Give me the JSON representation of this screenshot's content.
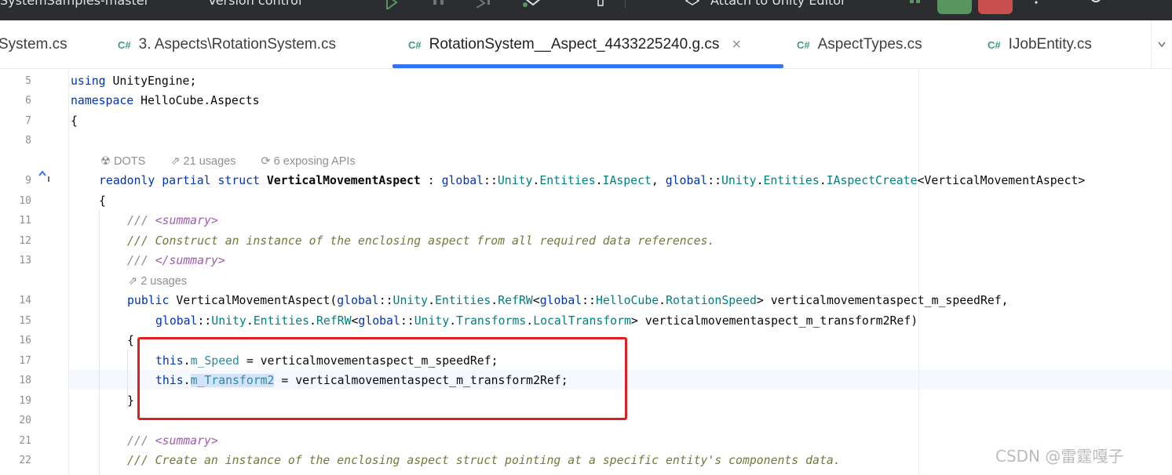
{
  "toolbar": {
    "project_name": "SystemSamples-master",
    "vcs_label": "Version control",
    "attach_label": "Attach to Unity Editor"
  },
  "tabs": [
    {
      "label": "System.cs",
      "cs": "",
      "active": false
    },
    {
      "label": "3. Aspects\\RotationSystem.cs",
      "cs": "C#",
      "active": false
    },
    {
      "label": "RotationSystem__Aspect_4433225240.g.cs",
      "cs": "C#",
      "active": true
    },
    {
      "label": "AspectTypes.cs",
      "cs": "C#",
      "active": false
    },
    {
      "label": "IJobEntity.cs",
      "cs": "C#",
      "active": false
    }
  ],
  "tab_close": "×",
  "inlay_hints": {
    "dots": "DOTS",
    "usages_21": "21 usages",
    "exposing": "6 exposing APIs",
    "usages_2": "2 usages"
  },
  "line_numbers": [
    "5",
    "6",
    "7",
    "8",
    "9",
    "10",
    "11",
    "12",
    "13",
    "14",
    "15",
    "16",
    "17",
    "18",
    "19",
    "20",
    "21",
    "22"
  ],
  "code": {
    "l5_kw": "using",
    "l5_rest": " UnityEngine;",
    "l6_kw": "namespace",
    "l6_rest": " HelloCube.Aspects",
    "l7": "{",
    "l9_kw1": "readonly",
    "l9_kw2": "partial",
    "l9_kw3": "struct",
    "l9_name": "VerticalMovementAspect",
    "l9_colon": " : ",
    "l9_g1": "global",
    "l9_sep": "::",
    "l9_unity": "Unity",
    "l9_entities": "Entities",
    "l9_iaspect": "IAspect",
    "l9_comma": ", ",
    "l9_g2": "global",
    "l9_iaspectcreate": "IAspectCreate",
    "l9_generic": "<VerticalMovementAspect>",
    "l10": "{",
    "l11_slash": "/// ",
    "l11_tag": "<summary>",
    "l12": "/// Construct an instance of the enclosing aspect from all required data references.",
    "l13_slash": "/// ",
    "l13_tag": "</summary>",
    "l14_public": "public",
    "l14_ctor": " VerticalMovementAspect(",
    "l14_global": "global",
    "l14_unity": "Unity",
    "l14_entities": "Entities",
    "l14_refrw": "RefRW",
    "l14_lt": "<",
    "l14_global2": "global",
    "l14_hellocube": "HelloCube",
    "l14_rotspeed": "RotationSpeed",
    "l14_param": "> verticalmovementaspect_m_speedRef,",
    "l15_global": "global",
    "l15_unity": "Unity",
    "l15_entities": "Entities",
    "l15_refrw": "RefRW",
    "l15_lt": "<",
    "l15_global2": "global",
    "l15_unity2": "Unity",
    "l15_transforms": "Transforms",
    "l15_localtransform": "LocalTransform",
    "l15_param": "> verticalmovementaspect_m_transform2Ref)",
    "l16": "{",
    "l17_this": "this",
    "l17_dot": ".",
    "l17_field": "m_Speed",
    "l17_rest": " = verticalmovementaspect_m_speedRef;",
    "l18_this": "this",
    "l18_dot": ".",
    "l18_field": "m_Transform2",
    "l18_rest": " = verticalmovementaspect_m_transform2Ref;",
    "l19": "}",
    "l21_slash": "/// ",
    "l21_tag": "<summary>",
    "l22": "/// Create an instance of the enclosing aspect struct pointing at a specific entity's components data."
  },
  "watermark": "CSDN @雷霆嘎子",
  "colors": {
    "accent": "#3574f0",
    "highlight_box": "#e02020",
    "keyword": "#0033b3",
    "type": "#008080",
    "comment": "#8c8c8c"
  }
}
